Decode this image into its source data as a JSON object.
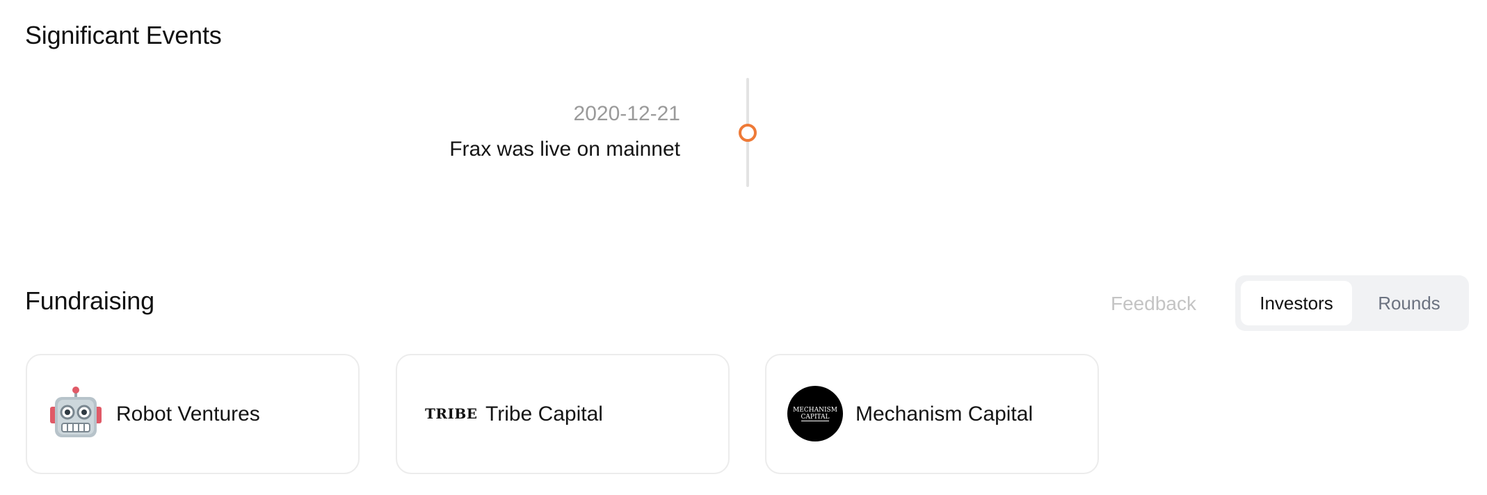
{
  "significant_events": {
    "title": "Significant Events",
    "events": [
      {
        "date": "2020-12-21",
        "description": "Frax was live on mainnet"
      }
    ],
    "accent_color": "#ee7a37"
  },
  "fundraising": {
    "title": "Fundraising",
    "feedback_label": "Feedback",
    "tabs": [
      {
        "label": "Investors",
        "active": true
      },
      {
        "label": "Rounds",
        "active": false
      }
    ],
    "investors": [
      {
        "name": "Robot Ventures",
        "logo_icon": "robot-icon"
      },
      {
        "name": "Tribe Capital",
        "logo_text": "TRIBE"
      },
      {
        "name": "Mechanism Capital",
        "logo_text_line1": "MECHANISM",
        "logo_text_line2": "CAPITAL"
      }
    ]
  }
}
